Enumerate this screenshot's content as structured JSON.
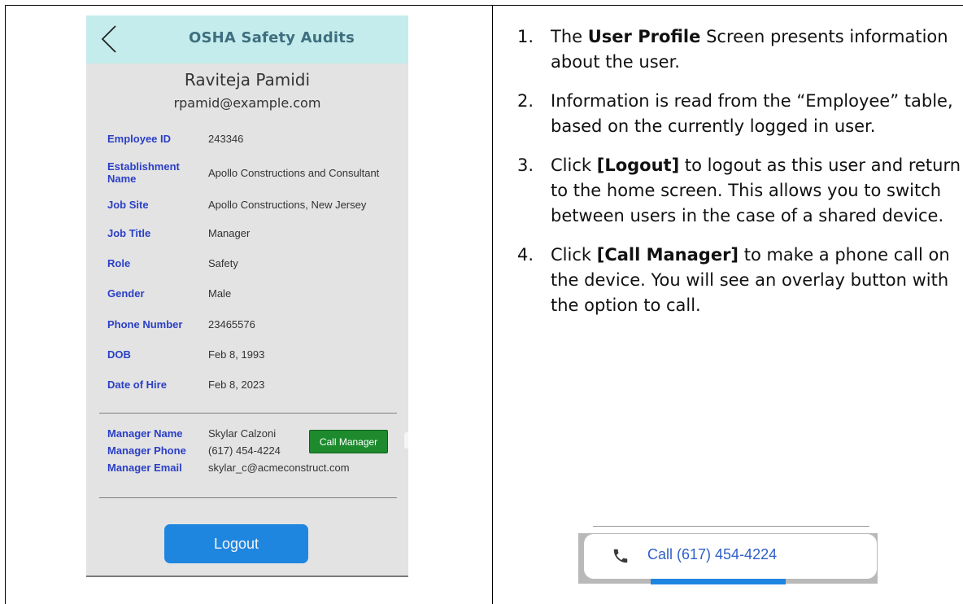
{
  "app": {
    "title": "OSHA Safety Audits",
    "user_name": "Raviteja Pamidi",
    "user_email": "rpamid@example.com"
  },
  "profile_fields": [
    {
      "label": "Employee ID",
      "value": "243346"
    },
    {
      "label": "Establishment Name",
      "value": "Apollo Constructions and Consultant"
    },
    {
      "label": "Job Site",
      "value": "Apollo Constructions, New Jersey"
    },
    {
      "label": "Job Title",
      "value": "Manager"
    },
    {
      "label": "Role",
      "value": "Safety"
    },
    {
      "label": "Gender",
      "value": "Male"
    },
    {
      "label": "Phone Number",
      "value": "23465576"
    },
    {
      "label": "DOB",
      "value": "Feb 8, 1993"
    },
    {
      "label": "Date of Hire",
      "value": "Feb 8, 2023"
    }
  ],
  "manager": {
    "name_label": "Manager Name",
    "name": "Skylar Calzoni",
    "phone_label": "Manager Phone",
    "phone": "(617) 454-4224",
    "email_label": "Manager Email",
    "email": "skylar_c@acmeconstruct.com",
    "call_button": "Call Manager"
  },
  "logout_button": "Logout",
  "instructions": [
    {
      "num": "1.",
      "before": "The ",
      "bold": "User Profile",
      "after": " Screen presents information about the user."
    },
    {
      "num": "2.",
      "before": "Information is read from the “Employee” table, based on the currently logged in user.",
      "bold": "",
      "after": ""
    },
    {
      "num": "3.",
      "before": "Click ",
      "bold": "[Logout]",
      "after": " to logout as this user and return to the home screen. This allows you to switch between users in the case of a shared device."
    },
    {
      "num": "4.",
      "before": "Click ",
      "bold": "[Call Manager]",
      "after": " to make a phone call on the device. You will see an overlay button with the option to call."
    }
  ],
  "call_overlay": {
    "text": "Call (617) 454-4224",
    "icon": "phone-icon"
  },
  "colors": {
    "header_bg": "#c4ecec",
    "label_blue": "#2a3fc6",
    "call_green": "#1d8a2e",
    "logout_blue": "#1f86e0",
    "overlay_link": "#2f5fc8"
  }
}
